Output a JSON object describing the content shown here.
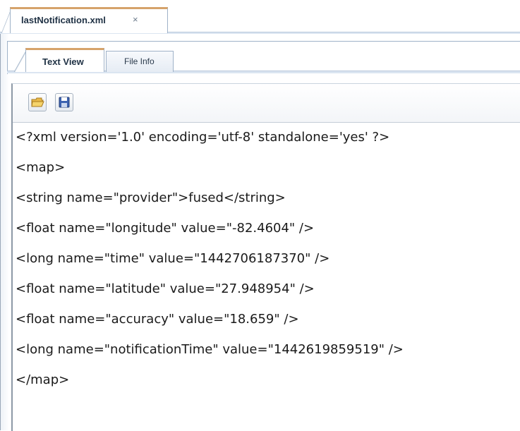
{
  "document_tab": {
    "label": "lastNotification.xml",
    "close_glyph": "×"
  },
  "subtabs": [
    {
      "label": "Text View",
      "active": true
    },
    {
      "label": "File Info",
      "active": false
    }
  ],
  "toolbar": {
    "buttons": [
      {
        "icon": "open-folder-icon"
      },
      {
        "icon": "save-disk-icon"
      }
    ]
  },
  "xml_lines": [
    "<?xml version='1.0' encoding='utf-8' standalone='yes' ?>",
    "<map>",
    "<string name=\"provider\">fused</string>",
    "<float name=\"longitude\" value=\"-82.4604\" />",
    "<long name=\"time\" value=\"1442706187370\" />",
    "<float name=\"latitude\" value=\"27.948954\" />",
    "<float name=\"accuracy\" value=\"18.659\" />",
    "<long name=\"notificationTime\" value=\"1442619859519\" />",
    "</map>"
  ],
  "colors": {
    "active_tab_accent": "#d6a36b",
    "tab_border": "#9fb2c8",
    "text": "#1a1a1a"
  }
}
